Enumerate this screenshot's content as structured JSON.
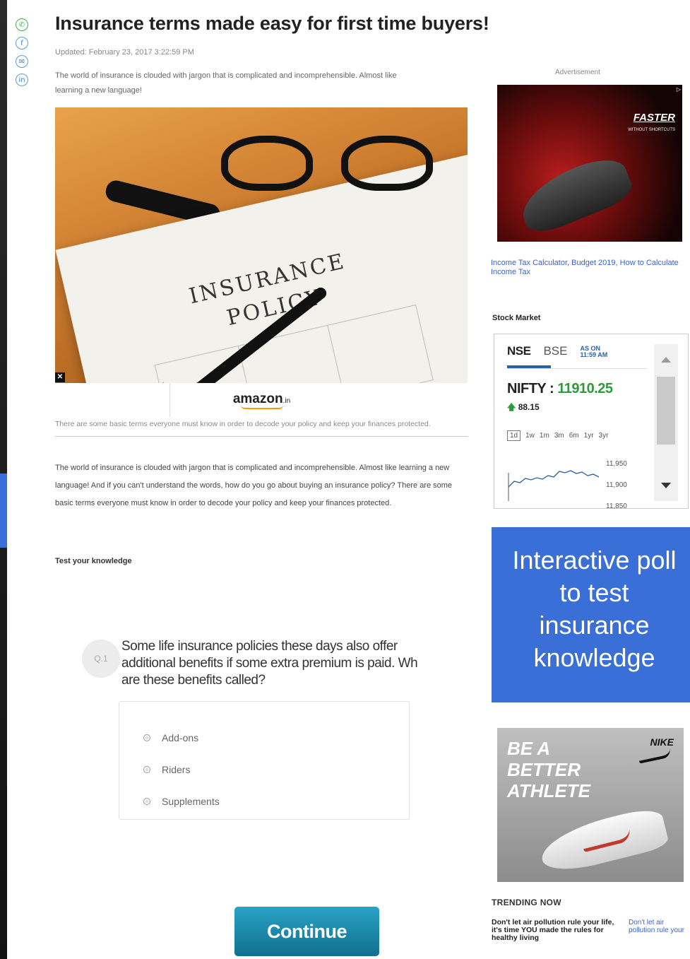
{
  "article": {
    "headline": "Insurance terms made easy for first time buyers!",
    "updated": "Updated: February 23, 2017 3:22:59 PM",
    "intro": "The world of insurance is clouded with jargon that is complicated and incomprehensible. Almost like learning a new language!",
    "image_words": {
      "line1": "INSURANCE",
      "line2": "POLICY"
    },
    "image_caption": "There are some basic terms everyone must know in order to decode your policy and keep your finances protected.",
    "body": "The world of insurance is clouded with jargon that is complicated and incomprehensible. Almost like learning a new language! And if you can't understand the words, how do you go about buying an insurance policy? There are some basic terms everyone must know in order to decode your policy and keep your finances protected.",
    "test_heading": "Test your knowledge"
  },
  "share_icons": [
    "whatsapp-icon",
    "facebook-icon",
    "messenger-icon",
    "linkedin-icon"
  ],
  "amazon": {
    "logo": "amazon",
    "suffix": ".in"
  },
  "quiz": {
    "number": "Q.1",
    "question": "Some life insurance policies these days also offer\nadditional benefits if some extra premium is paid. Wh\nare these benefits called?",
    "options": [
      "Add-ons",
      "Riders",
      "Supplements"
    ],
    "continue_label": "Continue"
  },
  "sidebar": {
    "ad_label": "Advertisement",
    "ad1": {
      "headline": "FASTER",
      "subline": "WITHOUT SHORTCUTS"
    },
    "tax_link": "Income Tax Calculator, Budget 2019, How to Calculate Income Tax",
    "stock_heading": "Stock Market",
    "stock": {
      "tab_nse": "NSE",
      "tab_bse": "BSE",
      "as_on_label": "AS ON",
      "as_on_time": "11:59 AM",
      "index_name": "NIFTY",
      "index_value": "11910.25",
      "change": "88.15",
      "ranges": [
        "1d",
        "1w",
        "1m",
        "3m",
        "6m",
        "1yr",
        "3yr"
      ],
      "selected_range": "1d",
      "y_ticks": [
        "11,950",
        "11,900",
        "11,850"
      ]
    },
    "callout": "Interactive poll\nto test\ninsurance\nknowledge",
    "ad2": {
      "text": "BE A\nBETTER\nATHLETE",
      "brand": "NIKE"
    },
    "trending_heading": "TRENDING NOW",
    "trending_text": "Don't let air pollution rule your life, it's time YOU made the rules for healthy living",
    "trending_link": "Don't let air pollution rule your"
  },
  "colors": {
    "callout": "#3a6fd8",
    "nifty_up": "#2f9a3a",
    "continue": "#1b87aa",
    "link": "#3a63c8"
  }
}
